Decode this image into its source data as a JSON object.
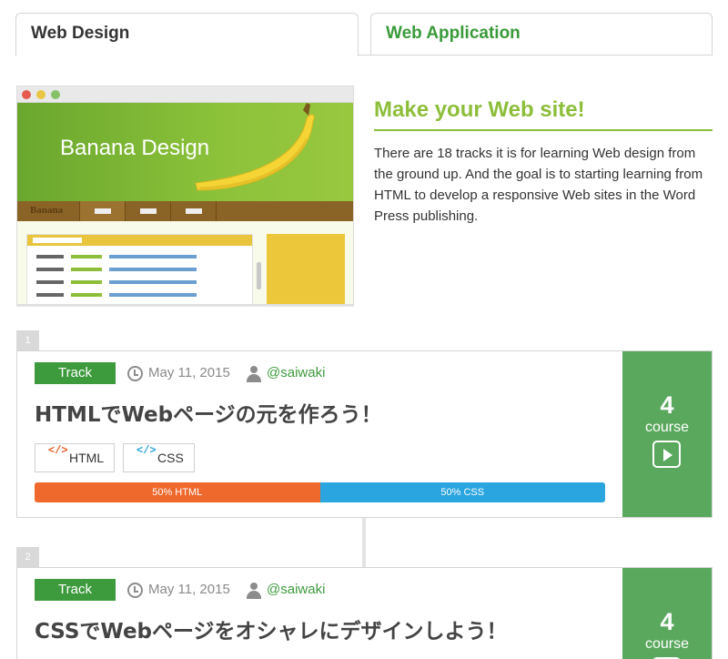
{
  "tabs": [
    {
      "label": "Web Design",
      "active": true
    },
    {
      "label": "Web Application",
      "active": false
    }
  ],
  "banner": {
    "mock_title": "Banana Design",
    "mock_brand": "Banana",
    "heading": "Make your Web site!",
    "description": "There are 18 tracks it is for learning Web design from the ground up. And the goal is to starting learning from HTML to develop a responsive Web sites in the Word Press publishing."
  },
  "tracks": [
    {
      "number": "1",
      "badge": "Track",
      "date": "May 11, 2015",
      "author": "@saiwaki",
      "title": "HTMLでWebページの元を作ろう！",
      "tags": [
        {
          "code": "</>",
          "label": "HTML"
        },
        {
          "code": "</>",
          "label": "CSS"
        }
      ],
      "progress": [
        {
          "label": "50% HTML",
          "fraction": 0.5,
          "color": "#f0692c"
        },
        {
          "label": "50% CSS",
          "fraction": 0.5,
          "color": "#2ba5e0"
        }
      ],
      "course_count": "4",
      "course_label": "course"
    },
    {
      "number": "2",
      "badge": "Track",
      "date": "May 11, 2015",
      "author": "@saiwaki",
      "title": "CSSでWebページをオシャレにデザインしよう！",
      "course_count": "4",
      "course_label": "course"
    }
  ],
  "colors": {
    "accent_green": "#3d9a3d",
    "lime": "#8dbe3a",
    "side_green": "#5aa85e"
  }
}
